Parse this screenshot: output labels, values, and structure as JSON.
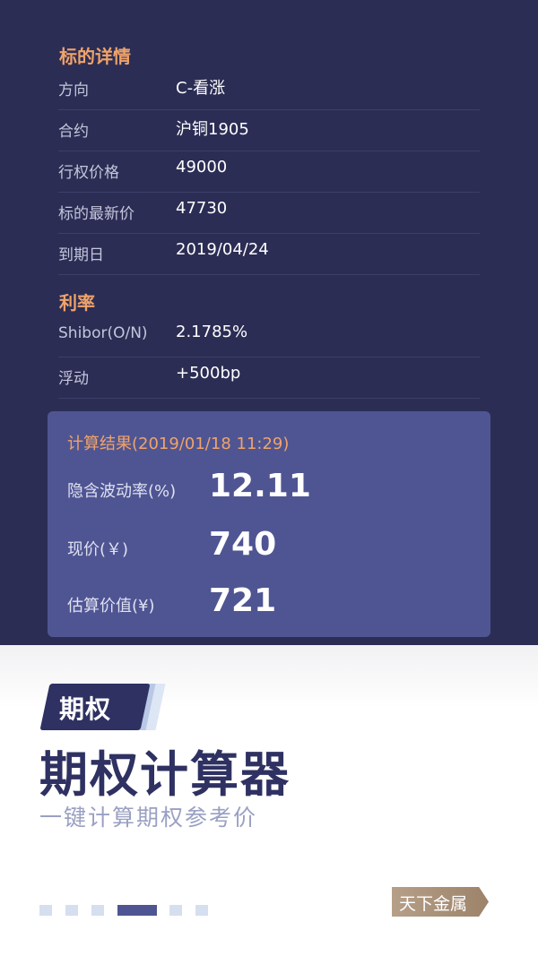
{
  "underlying": {
    "section_title": "标的详情",
    "rows": [
      {
        "label": "方向",
        "value": "C-看涨"
      },
      {
        "label": "合约",
        "value": "沪铜1905"
      },
      {
        "label": "行权价格",
        "value": "49000"
      },
      {
        "label": "标的最新价",
        "value": "47730"
      },
      {
        "label": "到期日",
        "value": "2019/04/24"
      }
    ]
  },
  "rate": {
    "section_title": "利率",
    "rows": [
      {
        "label": "Shibor(O/N)",
        "value": "2.1785%"
      },
      {
        "label": "浮动",
        "value": "+500bp"
      }
    ]
  },
  "result": {
    "title": "计算结果(2019/01/18 11:29)",
    "items": [
      {
        "label": "隐含波动率(%)",
        "value": "12.11"
      },
      {
        "label": "现价(￥)",
        "value": "740"
      },
      {
        "label": "估算价值(¥)",
        "value": "721"
      }
    ]
  },
  "promo": {
    "tag": "期权",
    "title": "期权计算器",
    "subtitle": "一键计算期权参考价",
    "brand": "天下金属",
    "pager": {
      "count": 6,
      "active_index": 3
    }
  },
  "colors": {
    "top_bg": "#2b2d54",
    "card_bg": "#4f5592",
    "accent": "#f0a36a",
    "title": "#2e3161"
  }
}
